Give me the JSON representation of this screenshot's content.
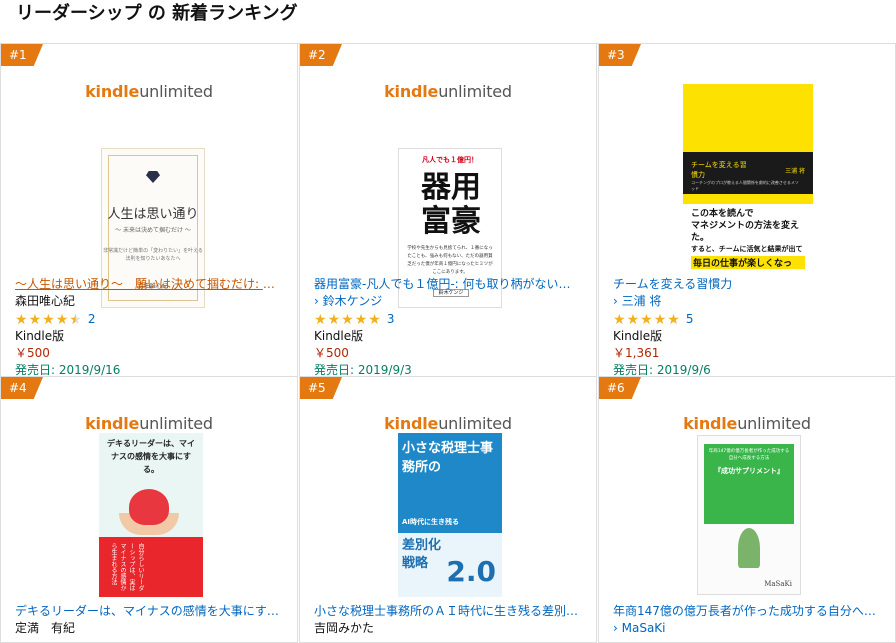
{
  "page": {
    "title": "リーダーシップ の 新着ランキング"
  },
  "brand": {
    "kindle": "kindle",
    "unlimited": "unlimited"
  },
  "items": [
    {
      "rank": "#1",
      "title": "〜人生は思い通り〜　願いは決めて掴むだけ: 非…",
      "author": "森田唯心紀",
      "author_is_link": false,
      "rating_stars": 4.5,
      "review_count": "2",
      "format": "Kindle版",
      "price": "￥500",
      "release": "発売日: 2019/9/16",
      "cover": {
        "title": "人生は思い通り",
        "subtitle": "〜 未来は決めて掴むだけ 〜",
        "desc": "非常識だけど簡単の「変わりたい」を叶える法則を知りたいあなたへ",
        "author": "森田唯心紀"
      }
    },
    {
      "rank": "#2",
      "title": "器用富豪-凡人でも１億円-: 何も取り柄がないけ…",
      "author": "› 鈴木ケンジ",
      "author_is_link": true,
      "rating_stars": 5,
      "review_count": "3",
      "format": "Kindle版",
      "price": "￥500",
      "release": "発売日: 2019/9/3",
      "cover": {
        "top": "凡人でも１億円！",
        "title": "器用富豪",
        "desc": "学校や先生からも見捨てられ、１番になったことも、強みも何もない、ただの器用貧乏だった僕が年商１億円になったヒミツがここにあります。",
        "author": "鈴木ケンジ"
      }
    },
    {
      "rank": "#3",
      "title": "チームを変える習慣力",
      "author": "› 三浦 将",
      "author_is_link": true,
      "rating_stars": 5,
      "review_count": "5",
      "format": "Kindle版",
      "price": "￥1,361",
      "release": "発売日: 2019/9/6",
      "cover": {
        "title": "チームを変える習慣力",
        "author": "三浦 将",
        "sub": "コーチングのプロが教える人間関係を劇的に改善させるメソッド",
        "band1": "この本を読んで",
        "band2": "マネジメントの方法を変えた。",
        "band3": "すると、チームに活気と結果が出て",
        "band4": "毎日の仕事が楽しくなった。"
      }
    },
    {
      "rank": "#4",
      "title": "デキるリーダーは、マイナスの感情を大事にす…",
      "author": "定満　有紀",
      "author_is_link": false,
      "cover": {
        "title": "デキるリーダーは、マイナスの感情を大事にする。",
        "vertical": "自分らしいリーダーシップは、実はマイナスの感情から生まれる方法"
      }
    },
    {
      "rank": "#5",
      "title": "小さな税理士事務所のＡＩ時代に生き残る差別化…",
      "author": "吉岡みかた",
      "author_is_link": false,
      "cover": {
        "title": "小さな税理士事務所の",
        "ai": "AI時代に生き残る",
        "head": "差別化戦略",
        "num": "2.0"
      }
    },
    {
      "rank": "#6",
      "title": "年商147億の億万長者が作った成功する自分へ成…",
      "author": "› MaSaKi",
      "author_is_link": true,
      "cover": {
        "top": "年商147億の億万長者が作った成功する自分へ成長する方法",
        "title": "『成功サプリメント』",
        "author": "MaSaKi"
      }
    }
  ]
}
